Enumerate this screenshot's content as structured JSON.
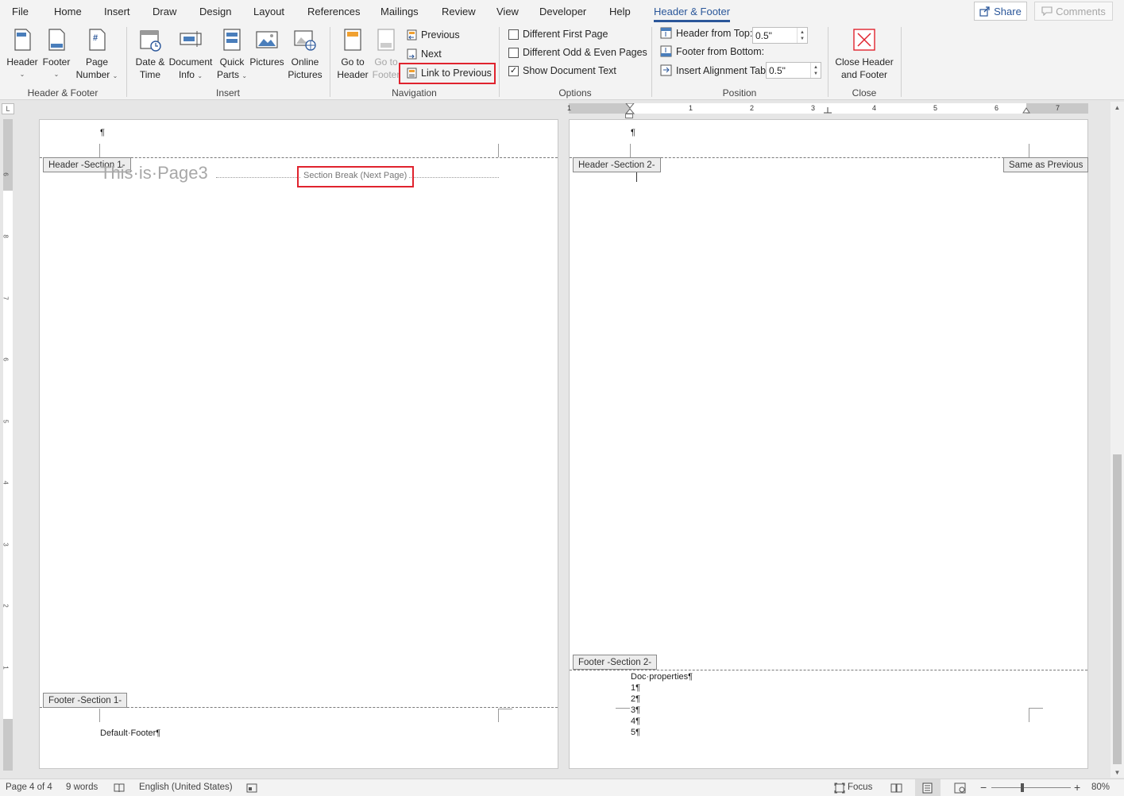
{
  "menu": {
    "tabs": [
      "File",
      "Home",
      "Insert",
      "Draw",
      "Design",
      "Layout",
      "References",
      "Mailings",
      "Review",
      "View",
      "Developer",
      "Help",
      "Header & Footer"
    ],
    "share_label": "Share",
    "comments_label": "Comments"
  },
  "ribbon": {
    "header_footer_group": {
      "label": "Header & Footer",
      "header": "Header",
      "footer": "Footer",
      "page_number_1": "Page",
      "page_number_2": "Number"
    },
    "insert_group": {
      "label": "Insert",
      "date_time_1": "Date &",
      "date_time_2": "Time",
      "doc_info_1": "Document",
      "doc_info_2": "Info",
      "quick_parts_1": "Quick",
      "quick_parts_2": "Parts",
      "pictures": "Pictures",
      "online_pictures_1": "Online",
      "online_pictures_2": "Pictures"
    },
    "navigation_group": {
      "label": "Navigation",
      "go_to_header_1": "Go to",
      "go_to_header_2": "Header",
      "go_to_footer_1": "Go to",
      "go_to_footer_2": "Footer",
      "previous": "Previous",
      "next": "Next",
      "link_to_previous": "Link to Previous"
    },
    "options_group": {
      "label": "Options",
      "different_first_page": "Different First Page",
      "different_odd_even": "Different Odd & Even Pages",
      "show_document_text": "Show Document Text",
      "different_first_page_checked": false,
      "different_odd_even_checked": false,
      "show_document_text_checked": true
    },
    "position_group": {
      "label": "Position",
      "header_from_top_label": "Header from Top:",
      "header_from_top_value": "0.5\"",
      "footer_from_bottom_label": "Footer from Bottom:",
      "footer_from_bottom_value": "0.5\"",
      "insert_alignment_tab": "Insert Alignment Tab"
    },
    "close_group": {
      "label": "Close",
      "close_1": "Close Header",
      "close_2": "and Footer"
    }
  },
  "ruler": {
    "h_numbers": [
      "1",
      "1",
      "2",
      "3",
      "4",
      "5",
      "6",
      "7"
    ],
    "v_numbers": [
      "6",
      "8",
      "7",
      "6",
      "5",
      "4",
      "3",
      "2",
      "1"
    ]
  },
  "page_left": {
    "header_tag": "Header -Section 1-",
    "para_mark": "¶",
    "ghost_text": "This·is·Page3",
    "section_break": "Section Break (Next Page)",
    "footer_tag": "Footer -Section 1-",
    "footer_text": "Default·Footer¶"
  },
  "page_right": {
    "header_tag": "Header -Section 2-",
    "same_as_previous": "Same as Previous",
    "para_mark": "¶",
    "footer_tag": "Footer -Section 2-",
    "footer_lines": [
      "Doc·properties¶",
      "1¶",
      "2¶",
      "3¶",
      "4¶",
      "5¶"
    ]
  },
  "status": {
    "page": "Page 4 of 4",
    "words": "9 words",
    "language": "English (United States)",
    "focus": "Focus",
    "zoom": "80%"
  },
  "colors": {
    "accent": "#2b579a",
    "highlight_box": "#e0232e"
  }
}
